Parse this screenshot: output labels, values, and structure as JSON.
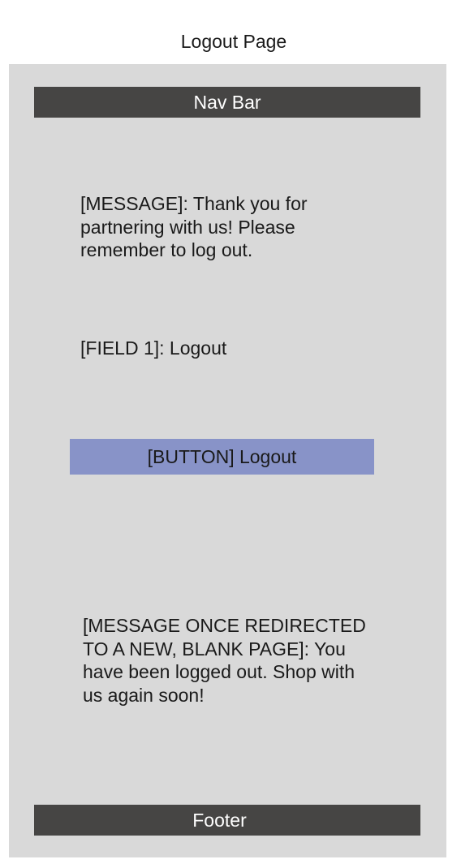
{
  "page_title": "Logout Page",
  "nav_bar": {
    "label": "Nav Bar"
  },
  "message": "[MESSAGE]: Thank you for partnering with us! Please remember to log out.",
  "field": "[FIELD 1]: Logout",
  "button": {
    "label": "[BUTTON] Logout"
  },
  "redirect_message": "[MESSAGE ONCE REDIRECTED TO A NEW, BLANK PAGE]: You have been logged out. Shop with us again soon!",
  "footer": {
    "label": "Footer"
  },
  "colors": {
    "frame": "#d9d9d9",
    "bars": "#464544",
    "button": "#8893c8"
  }
}
